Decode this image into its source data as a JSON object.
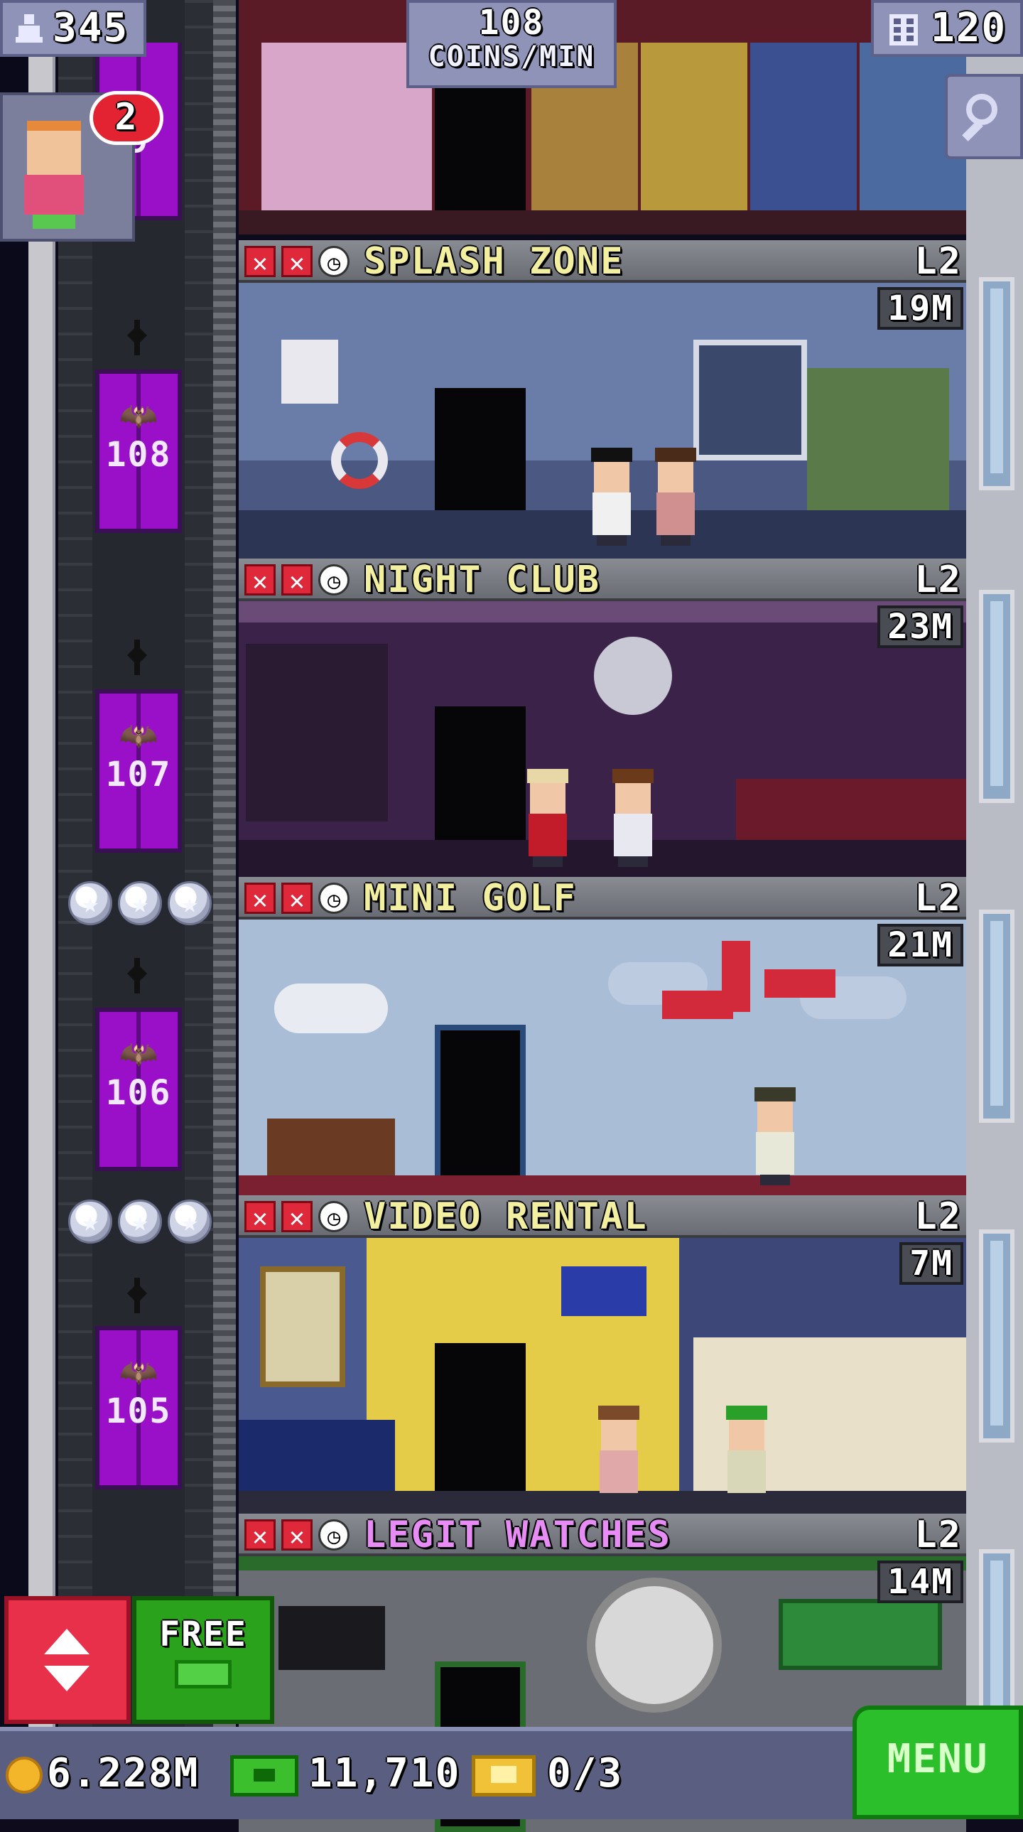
{
  "hud": {
    "population": "345",
    "coins_rate_value": "108",
    "coins_rate_unit": "COINS/MIN",
    "floor_count": "120"
  },
  "vip": {
    "badge_count": "2"
  },
  "elevator_numbers": [
    "108",
    "107",
    "106",
    "105"
  ],
  "floors": [
    {
      "name": "SPLASH ZONE",
      "level": "L2",
      "coins": "19M",
      "theme": "#3c4a6e",
      "wall": "#45557f"
    },
    {
      "name": "NIGHT CLUB",
      "level": "L2",
      "coins": "23M",
      "theme": "#3a2248",
      "wall": "#4a2c5c"
    },
    {
      "name": "MINI GOLF",
      "level": "L2",
      "coins": "21M",
      "theme": "#9db2cc",
      "wall": "#a9bdd6"
    },
    {
      "name": "VIDEO RENTAL",
      "level": "L2",
      "coins": "7M",
      "theme": "#d6c44a",
      "wall": "#3d4878"
    },
    {
      "name": "LEGIT WATCHES",
      "level": "L2",
      "coins": "14M",
      "theme": "#5a5c62",
      "wall": "#6a6d73"
    }
  ],
  "floor_name_colors": {
    "default": "#f3efa0",
    "special": "#e88cf5"
  },
  "partial_floor_label": "9",
  "bottom": {
    "free_label": "FREE",
    "coins": "6.228M",
    "bux": "11,710",
    "tickets": "0/3",
    "menu_label": "MENU"
  },
  "colors": {
    "hud_panel": "#8f93b8",
    "elevator": "#9a10c9",
    "elevator_button": "#e8304a",
    "free_button": "#2aa21c",
    "menu_button": "#2bbf2b"
  },
  "icons": [
    "population-icon",
    "floors-icon",
    "search-icon",
    "elevator-icon",
    "bux-icon",
    "coin-icon",
    "ticket-icon",
    "bat-icon",
    "star-icon",
    "clock-icon",
    "x-icon"
  ]
}
